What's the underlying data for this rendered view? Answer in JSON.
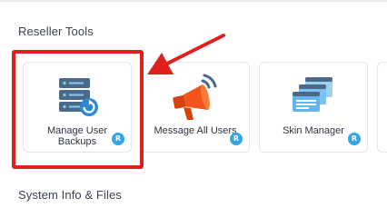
{
  "sections": {
    "reseller": {
      "title": "Reseller Tools"
    },
    "sysinfo": {
      "title": "System Info & Files"
    }
  },
  "tiles": [
    {
      "label": "Manage User Backups",
      "badge": "R",
      "icon": "server-backup-icon"
    },
    {
      "label": "Message All Users",
      "badge": "R",
      "icon": "megaphone-icon"
    },
    {
      "label": "Skin Manager",
      "badge": "R",
      "icon": "skin-layers-icon"
    }
  ],
  "colors": {
    "highlight": "#e0201e",
    "badge": "#32a6e6",
    "server": "#4a6a8c",
    "megaphone": "#f2541b",
    "skin": "#64b6e8"
  }
}
